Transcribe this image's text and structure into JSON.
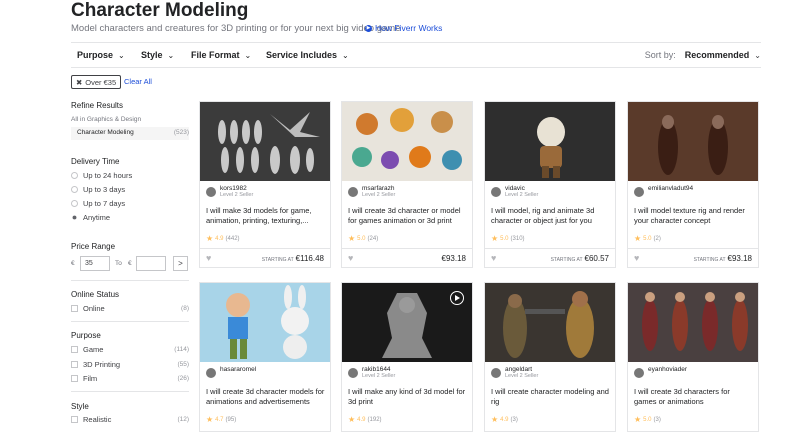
{
  "page": {
    "title": "Character Modeling",
    "subtitle": "Model characters and creatures for 3D printing or for your next big video game",
    "how_link": "How Fiverr Works"
  },
  "filters": {
    "purpose": "Purpose",
    "style": "Style",
    "file_format": "File Format",
    "service_includes": "Service Includes",
    "sort_label": "Sort by:",
    "sort_value": "Recommended"
  },
  "active_tag": {
    "label": "Over €35",
    "clear": "Clear All"
  },
  "sidebar": {
    "refine": "Refine Results",
    "category_parent": "All in Graphics & Design",
    "category": {
      "label": "Character Modeling",
      "count": "(523)"
    },
    "delivery": {
      "heading": "Delivery Time",
      "options": [
        "Up to 24 hours",
        "Up to 3 days",
        "Up to 7 days",
        "Anytime"
      ]
    },
    "price": {
      "heading": "Price Range",
      "currency": "€",
      "min": "35",
      "to": "To",
      "go": ">"
    },
    "online": {
      "heading": "Online Status",
      "label": "Online",
      "count": "(8)"
    },
    "purpose": {
      "heading": "Purpose",
      "items": [
        {
          "label": "Game",
          "count": "(114)"
        },
        {
          "label": "3D Printing",
          "count": "(55)"
        },
        {
          "label": "Film",
          "count": "(26)"
        }
      ]
    },
    "style": {
      "heading": "Style",
      "first": "Realistic",
      "first_count": "(12)"
    }
  },
  "cards": [
    {
      "seller": "kors1982",
      "level": "Level 2 Seller",
      "title": "I will make 3d models for game, animation, printing, texturing,...",
      "score": "4.9",
      "reviews": "(442)",
      "starting": "STARTING AT",
      "price": "€116.48"
    },
    {
      "seller": "msarfarazh",
      "level": "Level 2 Seller",
      "title": "I will create 3d character or model for games animation or 3d print",
      "score": "5.0",
      "reviews": "(24)",
      "starting": "",
      "price": "€93.18"
    },
    {
      "seller": "vidavic",
      "level": "Level 2 Seller",
      "title": "I will model, rig and animate 3d character or object just for you",
      "score": "5.0",
      "reviews": "(310)",
      "starting": "STARTING AT",
      "price": "€60.57"
    },
    {
      "seller": "emilianvladut94",
      "level": "",
      "title": "I will model texture rig and render your character concept",
      "score": "5.0",
      "reviews": "(2)",
      "starting": "STARTING AT",
      "price": "€93.18"
    },
    {
      "seller": "hasararomel",
      "level": "",
      "title": "I will create 3d character models for animations and advertisements",
      "score": "4.7",
      "reviews": "(95)",
      "starting": "",
      "price": ""
    },
    {
      "seller": "rakib1644",
      "level": "Level 2 Seller",
      "title": "I will make any kind of 3d model for 3d print",
      "score": "4.9",
      "reviews": "(192)",
      "starting": "",
      "price": ""
    },
    {
      "seller": "angeldart",
      "level": "Level 2 Seller",
      "title": "I will create character modeling and rig",
      "score": "4.9",
      "reviews": "(3)",
      "starting": "",
      "price": ""
    },
    {
      "seller": "eyanhoviader",
      "level": "",
      "title": "I will create 3d characters for games or animations",
      "score": "5.0",
      "reviews": "(3)",
      "starting": "",
      "price": ""
    }
  ]
}
